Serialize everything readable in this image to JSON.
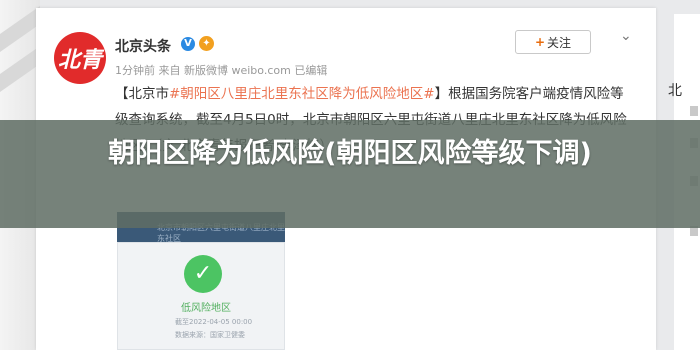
{
  "weibo_post": {
    "avatar_text": "北青",
    "author": "北京头条",
    "verified_symbol": "V",
    "meta": "1分钟前 来自 新版微博 weibo.com  已编辑",
    "follow_label": "关注",
    "post_text": {
      "part1": "【北京市",
      "link": "#朝阳区八里庄北里东社区降为低风险地区#",
      "part2": "】根据国务院客户端疫情风险等级查询系统，截至4月5日0时，北京市朝阳区六里屯街道八里庄北里东社区降为低风险地区。（文 北京青年报记者 李泽炜）"
    },
    "image": {
      "header_text": "北京市朝阳区六里屯街道八里庄北里东社区",
      "status_label": "低风险地区",
      "date_text": "截至2022-04-05 00:00",
      "note_text": "数据来源：国家卫健委"
    }
  },
  "right_card": {
    "label": "北"
  },
  "headline": "朝阳区降为低风险(朝阳区风险等级下调)",
  "colors": {
    "overlay": "#606e64",
    "link": "#eb7350",
    "verified": "#2b8ae2",
    "low_risk_green": "#4cc463"
  }
}
